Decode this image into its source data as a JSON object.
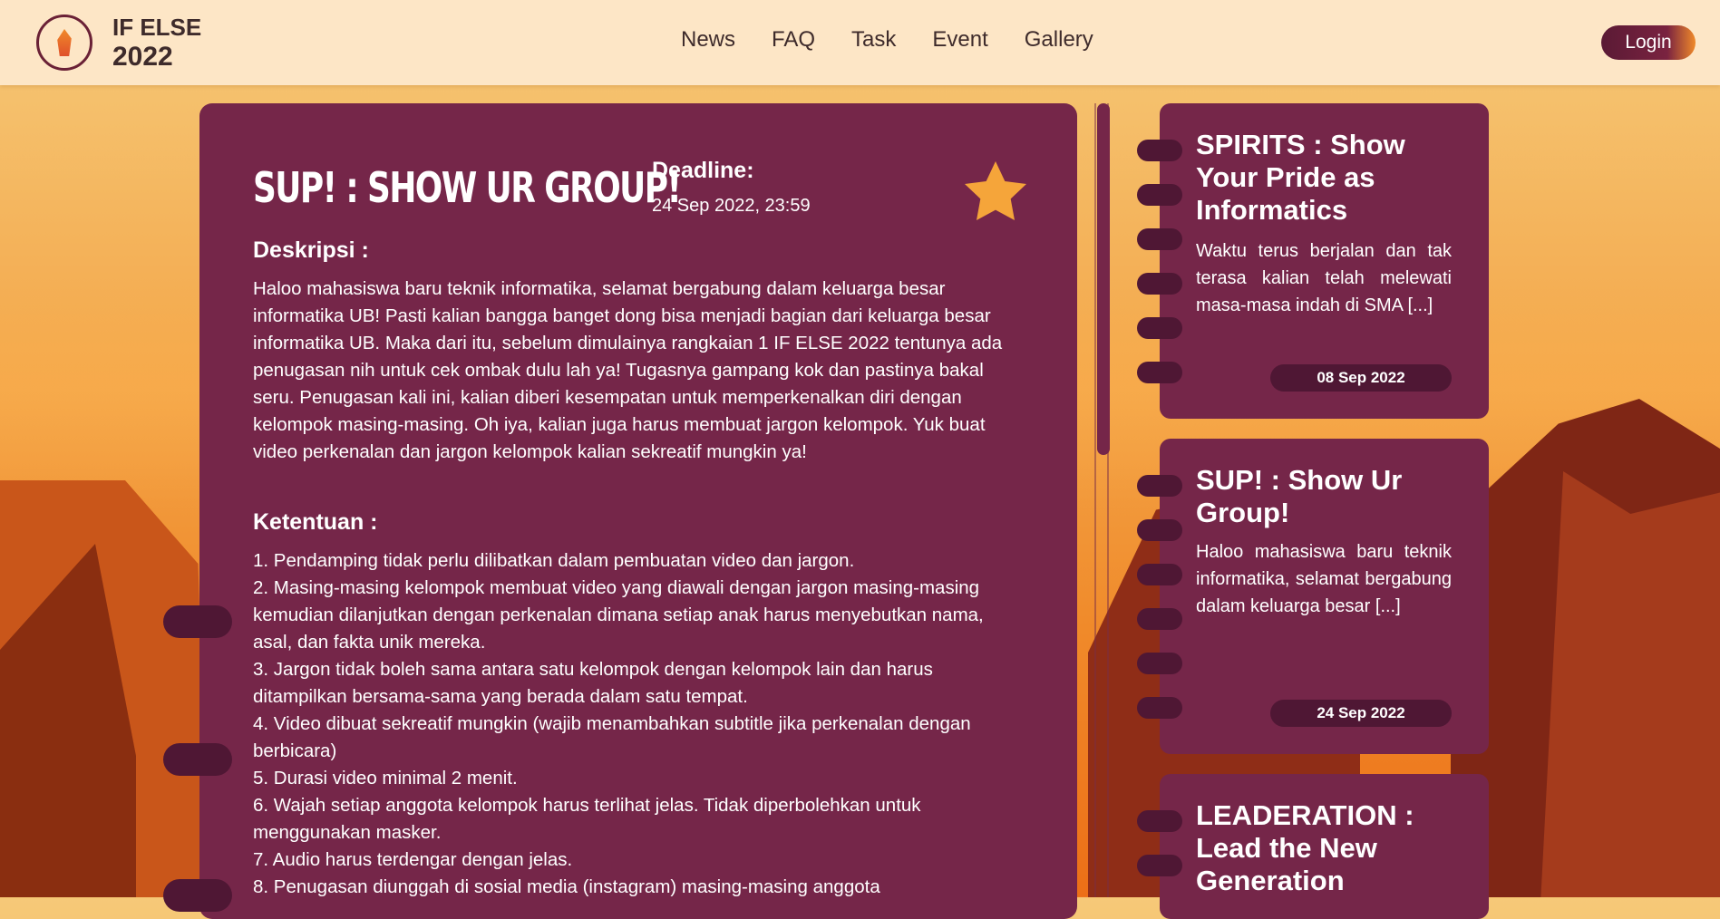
{
  "header": {
    "logo_title": "IF ELSE",
    "logo_year": "2022",
    "nav": [
      "News",
      "FAQ",
      "Task",
      "Event",
      "Gallery"
    ],
    "login_label": "Login"
  },
  "task": {
    "title": "SUP! : SHOW UR GROUP!",
    "deadline_label": "Deadline:",
    "deadline_value": "24 Sep 2022, 23:59",
    "desc_heading": "Deskripsi :",
    "description": "Haloo mahasiswa baru teknik informatika, selamat bergabung dalam keluarga besar informatika UB! Pasti kalian bangga banget dong bisa menjadi bagian dari keluarga besar informatika UB. Maka dari itu, sebelum dimulainya rangkaian 1 IF ELSE 2022 tentunya ada penugasan nih untuk cek ombak dulu lah ya! Tugasnya gampang kok dan pastinya bakal seru. Penugasan kali ini, kalian diberi kesempatan untuk memperkenalkan diri dengan kelompok masing-masing. Oh iya, kalian juga harus membuat jargon kelompok. Yuk buat video perkenalan dan jargon kelompok kalian sekreatif mungkin ya!",
    "rules_heading": "Ketentuan :",
    "rules": [
      "1. Pendamping tidak perlu dilibatkan dalam pembuatan video dan jargon.",
      "2. Masing-masing kelompok membuat video yang diawali dengan jargon masing-masing kemudian dilanjutkan dengan perkenalan dimana setiap anak harus menyebutkan nama, asal, dan fakta unik mereka.",
      "3. Jargon tidak boleh sama antara satu kelompok dengan kelompok lain dan  harus ditampilkan bersama-sama yang berada dalam satu tempat.",
      "4. Video dibuat sekreatif mungkin (wajib menambahkan subtitle jika perkenalan dengan berbicara)",
      "5. Durasi video minimal 2 menit.",
      "6. Wajah setiap anggota kelompok harus terlihat jelas. Tidak diperbolehkan untuk menggunakan masker.",
      "7. Audio harus terdengar dengan jelas.",
      "8. Penugasan diunggah di sosial media (instagram) masing-masing anggota"
    ]
  },
  "side_cards": [
    {
      "title": "SPIRITS : Show Your Pride as Informatics",
      "excerpt": "Waktu terus berjalan dan tak terasa kalian telah melewati masa-masa indah di SMA [...]",
      "date": "08 Sep 2022"
    },
    {
      "title": "SUP! : Show Ur Group!",
      "excerpt": "Haloo mahasiswa baru teknik informatika, selamat bergabung dalam keluarga besar [...]",
      "date": "24 Sep 2022"
    },
    {
      "title": "LEADERATION : Lead the New Generation",
      "excerpt": "",
      "date": ""
    }
  ],
  "colors": {
    "card": "#752649",
    "ring": "#4f1734",
    "header_bg": "#fde6c6",
    "star": "#f5a53a"
  }
}
